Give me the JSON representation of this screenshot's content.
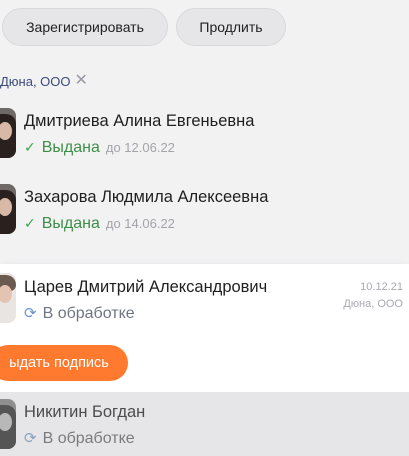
{
  "actions": {
    "register_label": "Зарегистрировать",
    "extend_label": "Продлить"
  },
  "filter": {
    "chip_label": "Дюна, ООО",
    "remove_icon": "close-icon"
  },
  "people": [
    {
      "name": "Дмитриева Алина Евгеньевна",
      "status": "Выдана",
      "until": "до 12.06.22",
      "status_icon": "check-icon"
    },
    {
      "name": "Захарова Людмила Алексеевна",
      "status": "Выдана",
      "until": "до 14.06.22",
      "status_icon": "check-icon"
    },
    {
      "name": "Царев Дмитрий Александрович",
      "status": "В обработке",
      "date": "10.12.21",
      "org": "Дюна, ООО",
      "action_label": "ыдать подпись",
      "status_icon": "refresh-icon"
    },
    {
      "name": "Никитин Богдан",
      "status": "В обработке",
      "status_icon": "refresh-icon"
    }
  ],
  "colors": {
    "accent": "#ff7a2e",
    "issued": "#3d8f47",
    "processing_icon": "#6a93c9"
  }
}
